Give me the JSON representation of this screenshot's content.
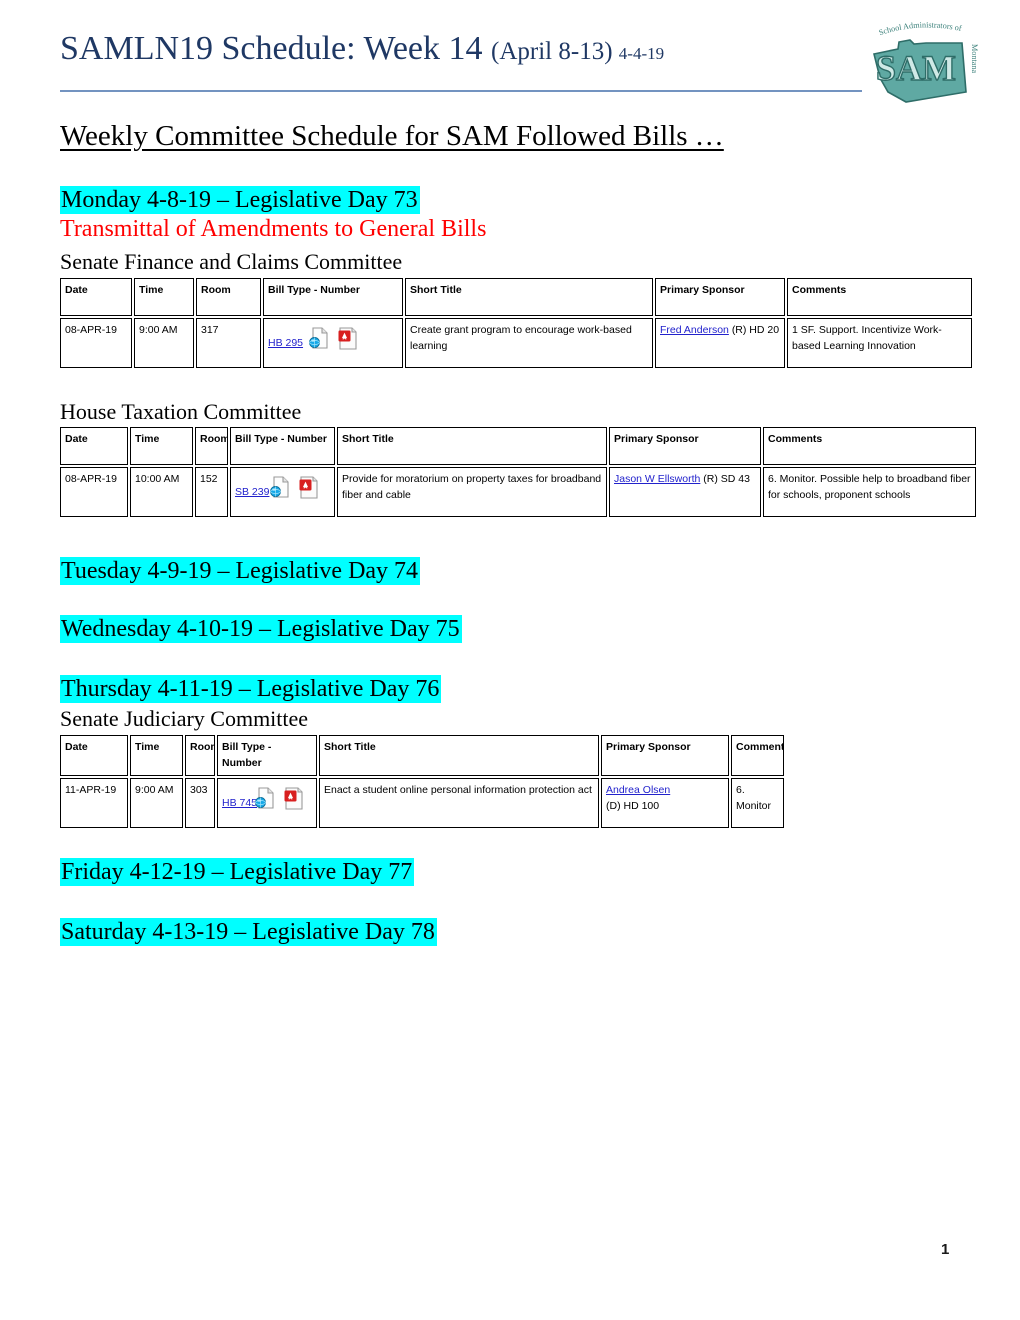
{
  "header": {
    "title_main": "SAMLN19 Schedule: Week 14 ",
    "title_paren": "(April 8-13) ",
    "title_date": "4-4-19",
    "logo": {
      "arc_text": "School Administrators of",
      "side_text": "Montana",
      "monogram": "SAM"
    },
    "rule_color": "#7393C0",
    "title_color": "#1F3864"
  },
  "subtitle": "Weekly Committee Schedule for SAM Followed Bills …",
  "colors": {
    "highlight": "#00FFFF",
    "alert_red": "#FF0000",
    "link_blue": "#2222CC"
  },
  "table_headers": [
    "Date",
    "Time",
    "Room",
    "Bill Type - Number",
    "Short Title",
    "Primary Sponsor",
    "Comments"
  ],
  "days": [
    {
      "heading": "Monday 4-8-19 – Legislative Day 73",
      "note": "Transmittal of Amendments to General Bills",
      "sections": [
        {
          "committee": "Senate Finance and Claims Committee",
          "rows": [
            {
              "date": "08-APR-19",
              "time": "9:00 AM",
              "room": "317",
              "bill": "HB 295",
              "icons": [
                "web-document-icon",
                "pdf-document-icon"
              ],
              "short_title": "Create grant program to encourage work-based learning",
              "sponsor_name": "Fred Anderson",
              "sponsor_meta": "(R) HD 20",
              "comments": "1 SF.  Support.  Incentivize Work-based Learning Innovation"
            }
          ]
        },
        {
          "committee": "House Taxation Committee",
          "rows": [
            {
              "date": "08-APR-19",
              "time": "10:00 AM",
              "room": "152",
              "bill": "SB 239",
              "icons": [
                "web-document-icon",
                "pdf-document-icon"
              ],
              "short_title": "Provide for moratorium on property taxes for broadband fiber and cable",
              "sponsor_name": "Jason W Ellsworth",
              "sponsor_meta": "(R) SD 43",
              "comments": "6. Monitor.  Possible help to broadband fiber for schools, proponent schools"
            }
          ]
        }
      ]
    },
    {
      "heading": "Tuesday 4-9-19 – Legislative Day 74",
      "note": "",
      "sections": []
    },
    {
      "heading": "Wednesday 4-10-19 – Legislative Day 75",
      "note": "",
      "sections": []
    },
    {
      "heading": "Thursday 4-11-19 – Legislative Day 76",
      "note": "",
      "sections": [
        {
          "committee": "Senate Judiciary Committee",
          "rows": [
            {
              "date": "11-APR-19",
              "time": "9:00 AM",
              "room": "303",
              "bill": "HB 745",
              "icons": [
                "web-document-icon",
                "pdf-document-icon"
              ],
              "short_title": "Enact a student online personal information protection act",
              "sponsor_name": "Andrea Olsen",
              "sponsor_meta": "(D) HD 100",
              "comments": "6. Monitor"
            }
          ]
        }
      ]
    },
    {
      "heading": "Friday 4-12-19 – Legislative Day 77",
      "note": "",
      "sections": []
    },
    {
      "heading": "Saturday 4-13-19 – Legislative Day 78",
      "note": "",
      "sections": []
    }
  ],
  "footer": {
    "page_number": "1"
  }
}
